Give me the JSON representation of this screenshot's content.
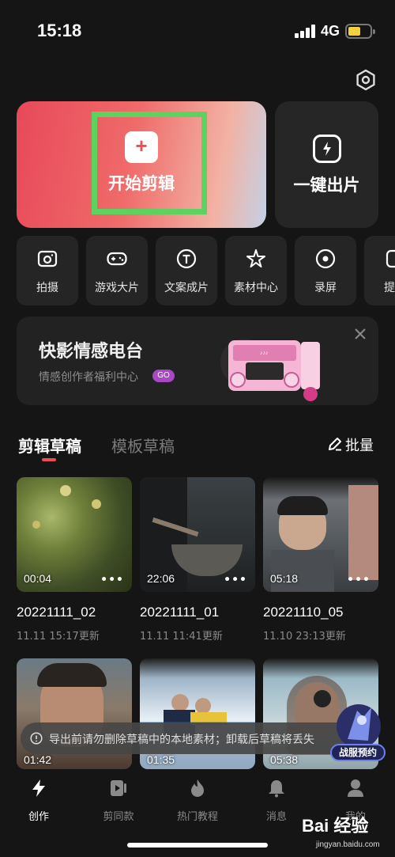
{
  "status_bar": {
    "time": "15:18",
    "network": "4G"
  },
  "hero": {
    "primary_label": "开始剪辑",
    "secondary_label": "一键出片"
  },
  "tools": [
    {
      "label": "拍摄",
      "icon": "camera-icon"
    },
    {
      "label": "游戏大片",
      "icon": "gamepad-icon"
    },
    {
      "label": "文案成片",
      "icon": "text-icon"
    },
    {
      "label": "素材中心",
      "icon": "sparkle-icon"
    },
    {
      "label": "录屏",
      "icon": "record-icon"
    },
    {
      "label": "提词",
      "icon": "teleprompter-icon"
    }
  ],
  "banner": {
    "title": "快影情感电台",
    "subtitle": "情感创作者福利中心",
    "badge": "GO"
  },
  "tabs": {
    "active": "剪辑草稿",
    "inactive": "模板草稿",
    "batch": "批量"
  },
  "drafts": [
    {
      "duration": "00:04",
      "name": "20221111_02",
      "date": "11.11 15:17更新"
    },
    {
      "duration": "22:06",
      "name": "20221111_01",
      "date": "11.11 11:41更新"
    },
    {
      "duration": "05:18",
      "name": "20221110_05",
      "date": "11.10 23:13更新"
    }
  ],
  "drafts_row2": [
    {
      "duration": "01:42"
    },
    {
      "duration": "01:35"
    },
    {
      "duration": "05:38"
    }
  ],
  "toast": {
    "text": "导出前请勿删除草稿中的本地素材；卸载后草稿将丢失"
  },
  "promo": {
    "label": "战服预约"
  },
  "nav": [
    {
      "label": "创作",
      "icon": "bolt-icon"
    },
    {
      "label": "剪同款",
      "icon": "play-icon"
    },
    {
      "label": "热门教程",
      "icon": "flame-icon"
    },
    {
      "label": "消息",
      "icon": "bell-icon"
    },
    {
      "label": "我的",
      "icon": "person-icon"
    }
  ],
  "watermark": {
    "brand": "Bai 经验",
    "url": "jingyan.baidu.com"
  },
  "colors": {
    "accent": "#ee4d57",
    "highlight_box": "#5cd35e",
    "background": "#151515"
  }
}
